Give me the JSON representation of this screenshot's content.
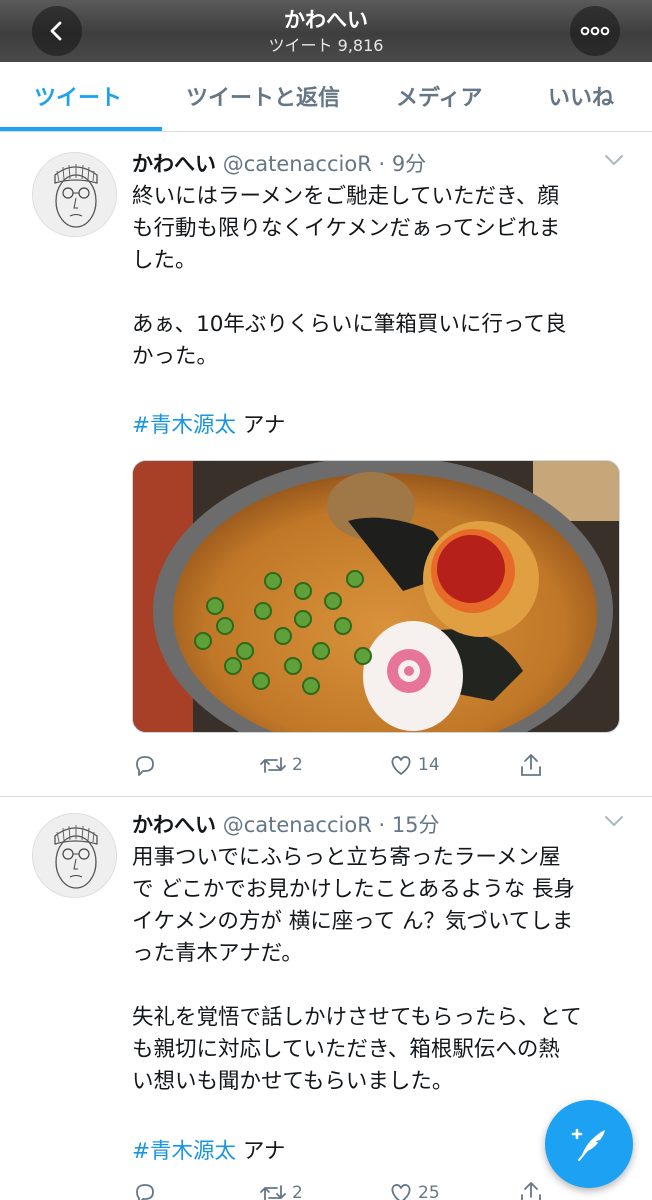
{
  "header": {
    "title": "かわへい",
    "subtitle": "ツイート 9,816"
  },
  "tabs": [
    {
      "label": "ツイート",
      "active": true
    },
    {
      "label": "ツイートと返信",
      "active": false
    },
    {
      "label": "メディア",
      "active": false
    },
    {
      "label": "いいね",
      "active": false
    }
  ],
  "tweets": [
    {
      "name": "かわへい",
      "meta": "@catenaccioR · 9分",
      "body": "終いにはラーメンをご馳走していただき、顔\nも行動も限りなくイケメンだぁってシビれま\nした。\n\nあぁ、10年ぶりくらいに筆箱買いに行って良\nかった。",
      "hashtag": "#青木源太",
      "after_hashtag": "アナ",
      "retweets": "2",
      "likes": "14"
    },
    {
      "name": "かわへい",
      "meta": "@catenaccioR · 15分",
      "body": "用事ついでにふらっと立ち寄ったラーメン屋\nで どこかでお見かけしたことあるような 長身\nイケメンの方が 横に座って ん？気づいてしま\nった青木アナだ。\n\n失礼を覚悟で話しかけさせてもらったら、とて\nも親切に対応していただき、箱根駅伝への熱\nい想いも聞かせてもらいました。",
      "hashtag": "#青木源太",
      "after_hashtag": "アナ",
      "retweets": "2",
      "likes": "25"
    }
  ],
  "colors": {
    "accent": "#1da1f2",
    "hashtag": "#1b95e0",
    "muted": "#657786"
  },
  "icons": {
    "back": "chevron-left-icon",
    "more": "more-dots-icon",
    "reply": "reply-icon",
    "retweet": "retweet-icon",
    "like": "heart-icon",
    "share": "share-icon",
    "compose": "compose-feather-icon"
  }
}
